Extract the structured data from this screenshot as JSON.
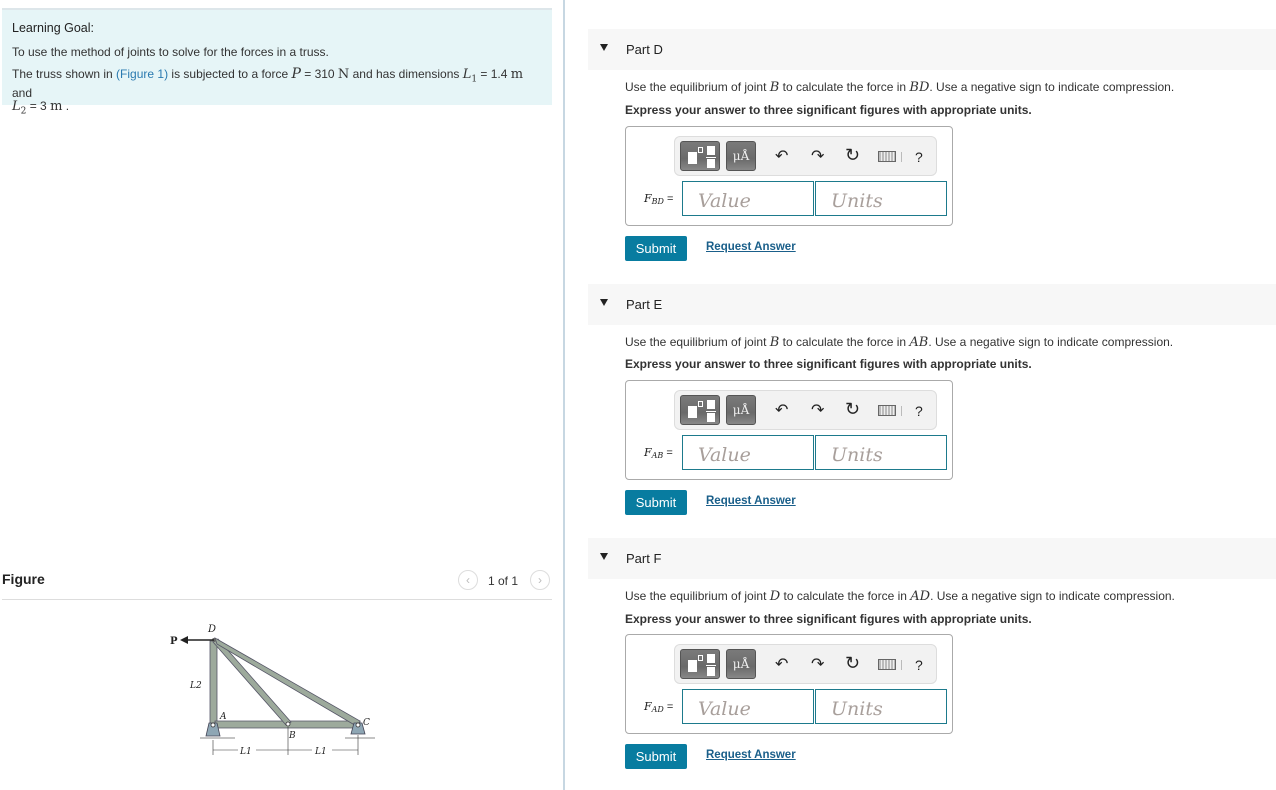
{
  "learning_goal": {
    "title": "Learning Goal:",
    "objective": "To use the method of joints to solve for the forces in a truss.",
    "intro_before_link": "The truss shown in ",
    "figure_link": "(Figure 1)",
    "intro_after_link": " is subjected to a force ",
    "P_symbol": "P",
    "P_value": " = 310 ",
    "P_unit": "N",
    "mid_text": " and has dimensions ",
    "L1_symbol": "L",
    "L1_sub": "1",
    "L1_value": " = 1.4 ",
    "L1_unit": "m",
    "and_text": " and",
    "L2_symbol": "L",
    "L2_sub": "2",
    "L2_value": " = 3 ",
    "L2_unit": "m",
    "end": " ."
  },
  "figure": {
    "title": "Figure",
    "pager": {
      "count": "1 of 1",
      "prev_icon": "chevron-left-icon",
      "next_icon": "chevron-right-icon"
    },
    "labels": {
      "P": "P",
      "D": "D",
      "A": "A",
      "B": "B",
      "C": "C",
      "L2": "L2",
      "L1": "L1"
    }
  },
  "parts": [
    {
      "label": "Part D",
      "q_before": "Use the equilibrium of joint ",
      "joint": "B",
      "q_mid": " to calculate the force in ",
      "member": "BD",
      "q_after": ". Use a negative sign to indicate compression.",
      "instruction": "Express your answer to three significant figures with appropriate units.",
      "var": "F",
      "var_sub": "BD",
      "equals": "=",
      "value_placeholder": "Value",
      "units_placeholder": "Units",
      "submit": "Submit",
      "request": "Request Answer"
    },
    {
      "label": "Part E",
      "q_before": "Use the equilibrium of joint ",
      "joint": "B",
      "q_mid": " to calculate the force in ",
      "member": "AB",
      "q_after": ". Use a negative sign to indicate compression.",
      "instruction": "Express your answer to three significant figures with appropriate units.",
      "var": "F",
      "var_sub": "AB",
      "equals": "=",
      "value_placeholder": "Value",
      "units_placeholder": "Units",
      "submit": "Submit",
      "request": "Request Answer"
    },
    {
      "label": "Part F",
      "q_before": "Use the equilibrium of joint ",
      "joint": "D",
      "q_mid": " to calculate the force in ",
      "member": "AD",
      "q_after": ". Use a negative sign to indicate compression.",
      "instruction": "Express your answer to three significant figures with appropriate units.",
      "var": "F",
      "var_sub": "AD",
      "equals": "=",
      "value_placeholder": "Value",
      "units_placeholder": "Units",
      "submit": "Submit",
      "request": "Request Answer"
    }
  ],
  "toolbar": {
    "units_label": "μÅ",
    "undo_glyph": "↶",
    "redo_glyph": "↷",
    "reset_glyph": "↻",
    "help_label": "?"
  },
  "colors": {
    "accent": "#087ca0",
    "goal_bg": "#e6f5f7",
    "field_border": "#1d7a8c",
    "link": "#2a7ab0"
  }
}
